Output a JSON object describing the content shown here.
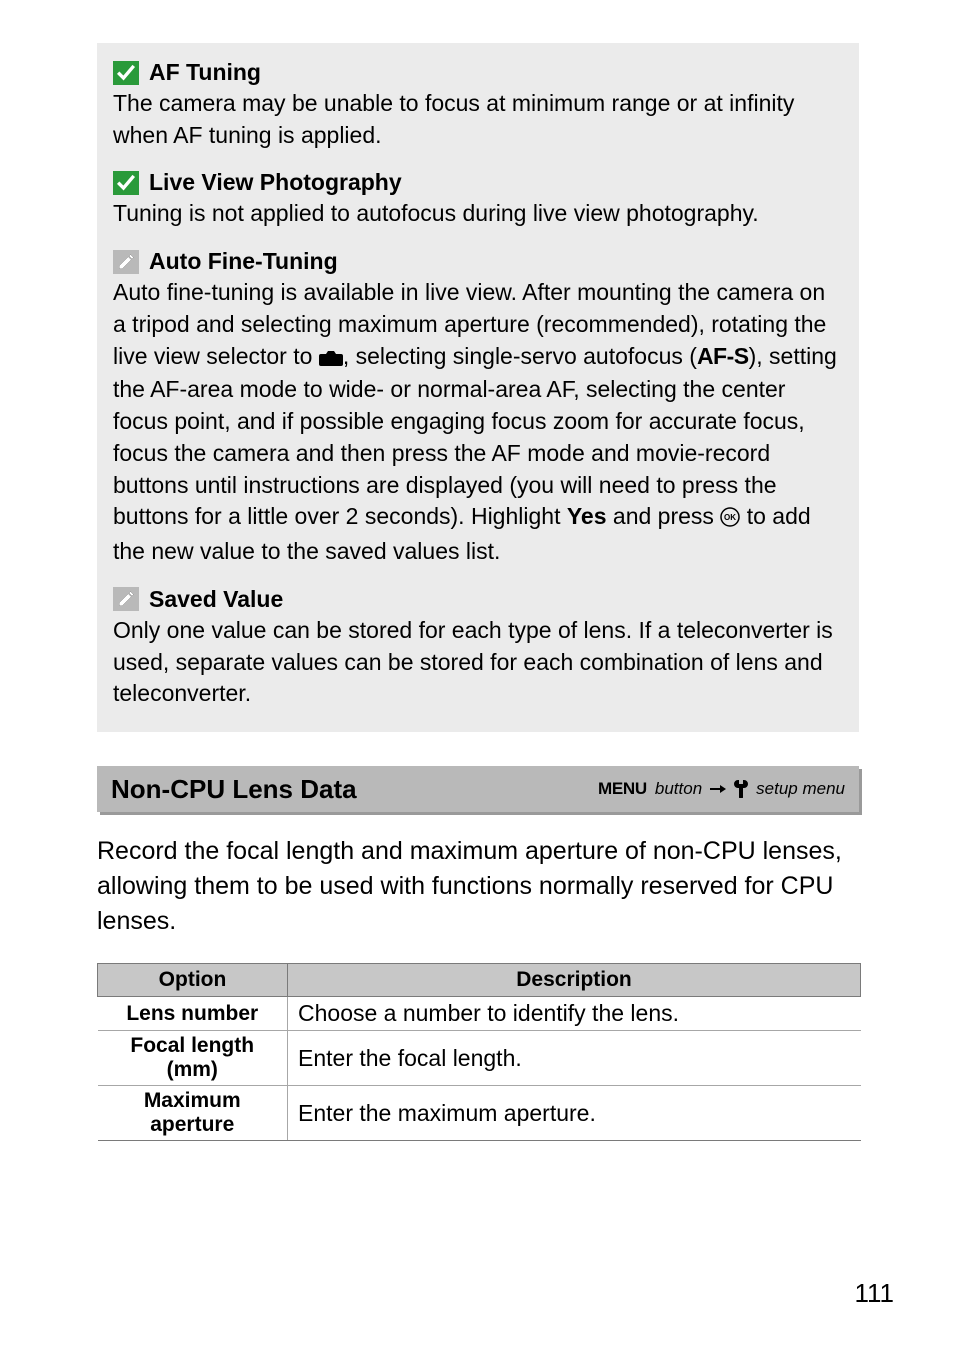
{
  "notes": [
    {
      "icon": "check",
      "title": "AF Tuning",
      "body_html": "The camera may be unable to focus at minimum range or at infinity when AF tuning is applied."
    },
    {
      "icon": "check",
      "title": "Live View Photography",
      "body_html": "Tuning is not applied to autofocus during live view photography."
    },
    {
      "icon": "pencil",
      "title": "Auto Fine-Tuning",
      "body_html": "Auto fine-tuning is available in live view.  After mounting the camera on a tripod and selecting maximum aperture (recommended), rotating the live view selector to {{CAM}}, selecting single-servo autofocus (<span class='cond'>AF-S</span>), setting the AF-area mode to wide- or normal-area AF, selecting the center focus point, and if possible engaging focus zoom for accurate focus, focus the camera and then press the AF mode and movie-record buttons until instructions are displayed (you will need to press the buttons for a little over 2 seconds).  Highlight <span class='bold'>Yes</span> and press {{OK}} to add the new value to the saved values list."
    },
    {
      "icon": "pencil",
      "title": "Saved Value",
      "body_html": "Only one value can be stored for each type of lens.  If a teleconverter is used, separate values can be stored for each combination of lens and teleconverter."
    }
  ],
  "section": {
    "title": "Non-CPU Lens Data",
    "breadcrumb": {
      "menu": "MENU",
      "button": "button",
      "setup": "setup menu"
    },
    "body": "Record the focal length and maximum aperture of non-CPU lenses, allowing them to be used with functions normally reserved for CPU lenses."
  },
  "table": {
    "headers": [
      "Option",
      "Description"
    ],
    "rows": [
      {
        "option": "Lens number",
        "desc": "Choose a number to identify the lens."
      },
      {
        "option": "Focal length (mm)",
        "desc": "Enter the focal length."
      },
      {
        "option": "Maximum aperture",
        "desc": "Enter the maximum aperture."
      }
    ]
  },
  "page_number": "111"
}
